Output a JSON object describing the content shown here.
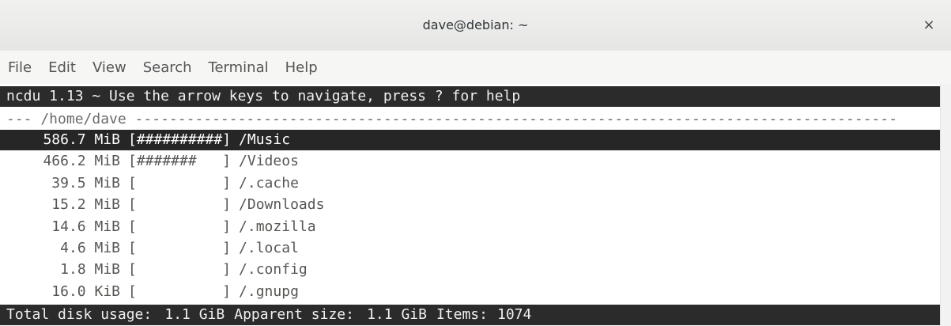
{
  "window": {
    "title": "dave@debian: ~",
    "close_label": "×"
  },
  "menu": {
    "items": [
      "File",
      "Edit",
      "View",
      "Search",
      "Terminal",
      "Help"
    ]
  },
  "terminal": {
    "header": "ncdu 1.13 ~ Use the arrow keys to navigate, press ? for help",
    "directory_line": "--- /home/dave -----------------------------------------------------------------------------------------",
    "entries": [
      {
        "size": "586.7 MiB",
        "bar": "[##########]",
        "name": "/Music",
        "selected": true
      },
      {
        "size": "466.2 MiB",
        "bar": "[#######   ]",
        "name": "/Videos",
        "selected": false
      },
      {
        "size": "39.5 MiB",
        "bar": "[          ]",
        "name": "/.cache",
        "selected": false
      },
      {
        "size": "15.2 MiB",
        "bar": "[          ]",
        "name": "/Downloads",
        "selected": false
      },
      {
        "size": "14.6 MiB",
        "bar": "[          ]",
        "name": "/.mozilla",
        "selected": false
      },
      {
        "size": "4.6 MiB",
        "bar": "[          ]",
        "name": "/.local",
        "selected": false
      },
      {
        "size": "1.8 MiB",
        "bar": "[          ]",
        "name": "/.config",
        "selected": false
      },
      {
        "size": "16.0 KiB",
        "bar": "[          ]",
        "name": "/.gnupg",
        "selected": false
      }
    ],
    "footer": {
      "total_label": "Total disk usage:",
      "total_value": "1.1 GiB",
      "apparent_label": "Apparent size:",
      "apparent_value": "1.1 GiB",
      "items_label": "Items:",
      "items_value": "1074"
    }
  }
}
